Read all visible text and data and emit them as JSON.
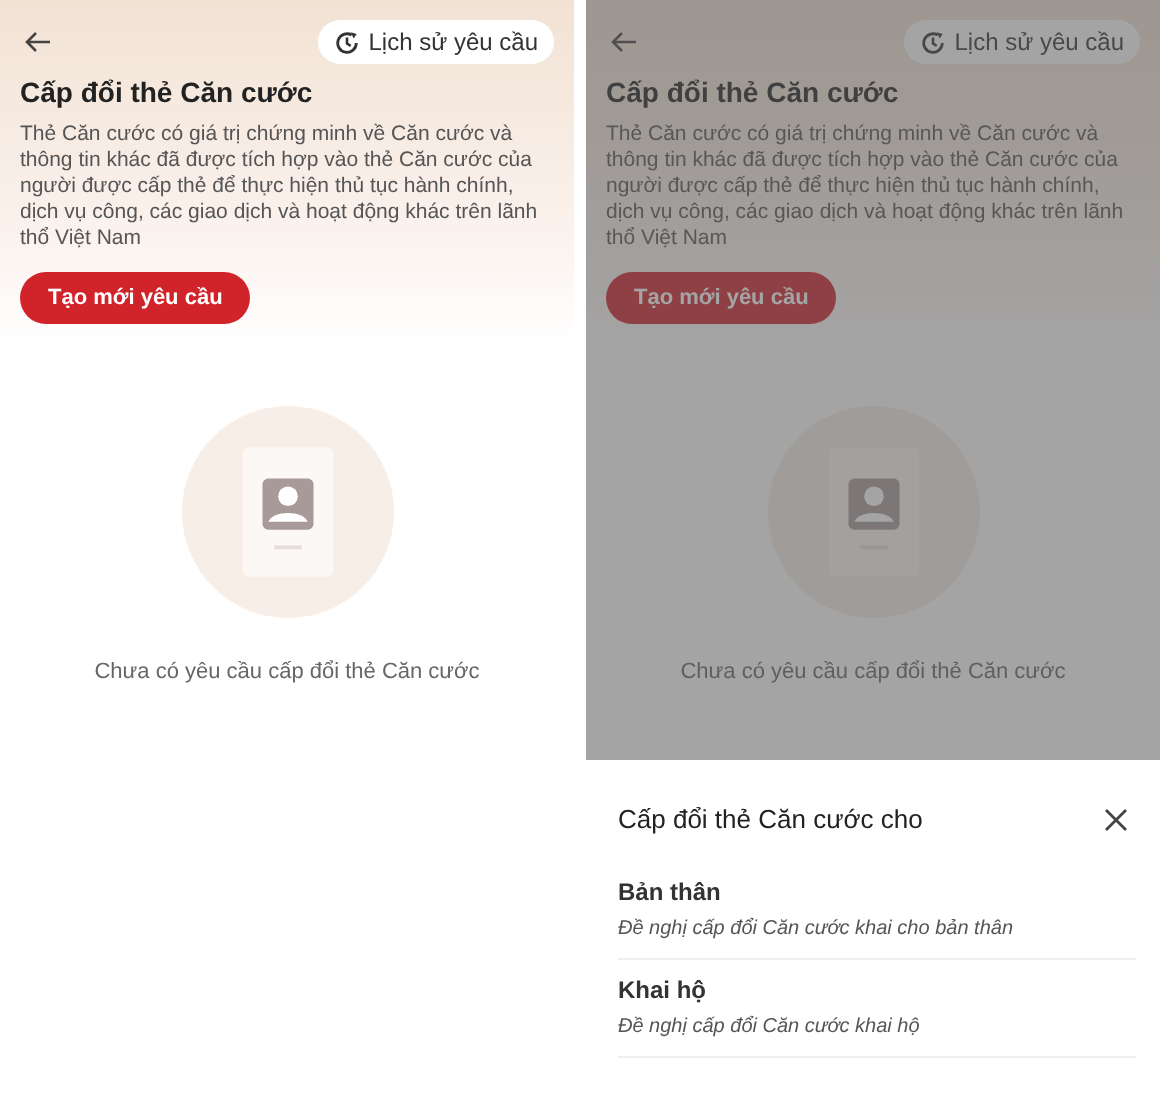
{
  "screens": [
    {
      "history_button": "Lịch sử yêu cầu",
      "title": "Cấp đổi thẻ Căn cước",
      "description": "Thẻ Căn cước có giá trị chứng minh về Căn cước và thông tin khác đã được tích hợp vào thẻ Căn cước của người được cấp thẻ để thực hiện thủ tục hành chính, dịch vụ công, các giao dịch và hoạt động khác trên lãnh thổ Việt Nam",
      "create_button": "Tạo mới yêu cầu",
      "empty_text": "Chưa có yêu cầu cấp đổi thẻ Căn cước",
      "dimmed": false
    },
    {
      "history_button": "Lịch sử yêu cầu",
      "title": "Cấp đổi thẻ Căn cước",
      "description": "Thẻ Căn cước có giá trị chứng minh về Căn cước và thông tin khác đã được tích hợp vào thẻ Căn cước của người được cấp thẻ để thực hiện thủ tục hành chính, dịch vụ công, các giao dịch và hoạt động khác trên lãnh thổ Việt Nam",
      "create_button": "Tạo mới yêu cầu",
      "empty_text": "Chưa có yêu cầu cấp đổi thẻ Căn cước",
      "dimmed": true,
      "sheet": {
        "title": "Cấp đổi thẻ Căn cước cho",
        "options": [
          {
            "label": "Bản thân",
            "description": "Đề nghị cấp đổi Căn cước khai cho bản thân"
          },
          {
            "label": "Khai hộ",
            "description": "Đề nghị cấp đổi Căn cước khai hộ"
          }
        ]
      }
    }
  ]
}
